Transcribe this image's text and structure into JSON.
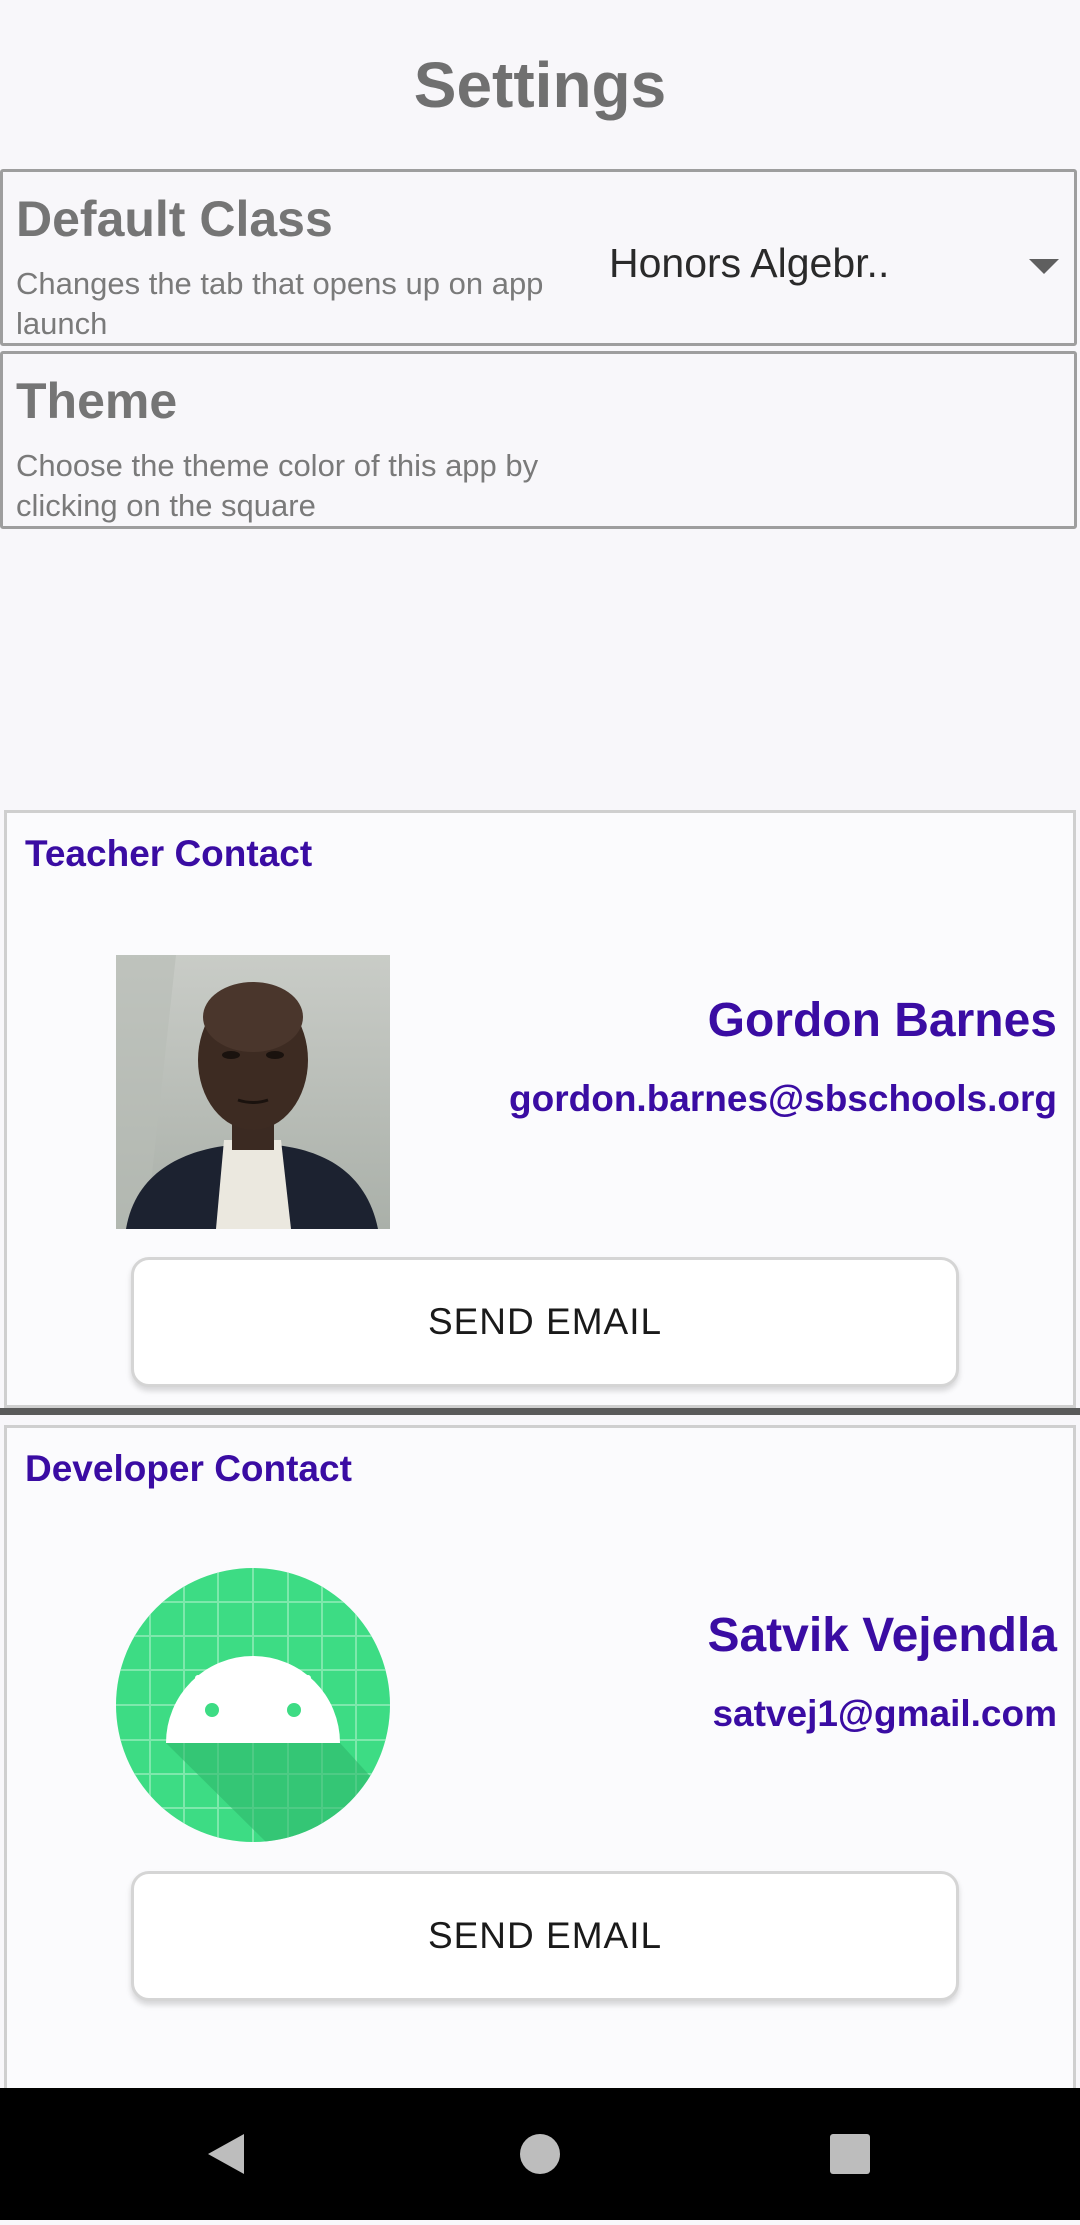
{
  "page": {
    "title": "Settings"
  },
  "settings": {
    "default_class": {
      "title": "Default Class",
      "description": "Changes the tab that opens up on app launch",
      "selected": "Honors Algebr.."
    },
    "theme": {
      "title": "Theme",
      "description": "Choose the theme color of this app by clicking on the square"
    }
  },
  "teacher": {
    "header": "Teacher Contact",
    "name": "Gordon Barnes",
    "email": "gordon.barnes@sbschools.org",
    "button": "SEND EMAIL"
  },
  "developer": {
    "header": "Developer Contact",
    "name": "Satvik Vejendla",
    "email": "satvej1@gmail.com",
    "button": "SEND EMAIL"
  },
  "colors": {
    "accent": "#3a0ca3",
    "android_green": "#3ddc84",
    "background": "#f8f7fa"
  },
  "navbar": {
    "icons": [
      "back-icon",
      "home-icon",
      "recents-icon"
    ]
  }
}
